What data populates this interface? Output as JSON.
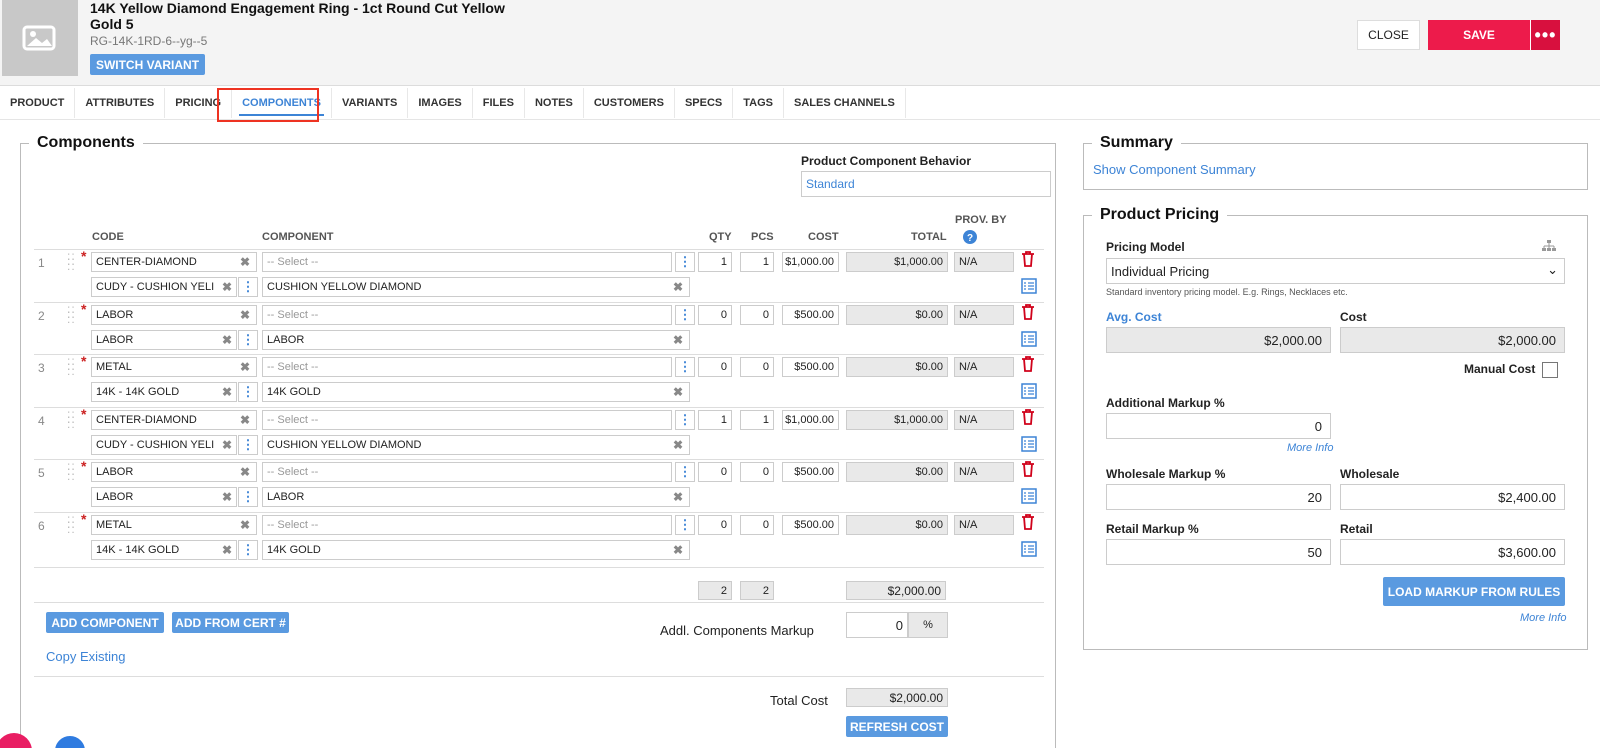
{
  "header": {
    "title": "14K Yellow Diamond Engagement Ring - 1ct Round Cut Yellow Gold 5",
    "sku": "RG-14K-1RD-6--yg--5",
    "switch_variant": "SWITCH VARIANT",
    "close": "CLOSE",
    "save": "SAVE",
    "more": "•••"
  },
  "tabs": [
    "PRODUCT",
    "ATTRIBUTES",
    "PRICING",
    "COMPONENTS",
    "VARIANTS",
    "IMAGES",
    "FILES",
    "NOTES",
    "CUSTOMERS",
    "SPECS",
    "TAGS",
    "SALES CHANNELS"
  ],
  "active_tab": "COMPONENTS",
  "components": {
    "legend": "Components",
    "behavior_label": "Product Component Behavior",
    "behavior_value": "Standard",
    "columns": {
      "code": "CODE",
      "component": "COMPONENT",
      "qty": "QTY",
      "pcs": "PCS",
      "cost": "COST",
      "total": "TOTAL",
      "prov_by": "PROV. BY"
    },
    "rows": [
      {
        "num": "1",
        "code": "CENTER-DIAMOND",
        "select": "-- Select --",
        "qty": "1",
        "pcs": "1",
        "cost": "$1,000.00",
        "total": "$1,000.00",
        "prov": "N/A",
        "sub_code": "CUDY - CUSHION YELI",
        "sub_component": "CUSHION YELLOW DIAMOND"
      },
      {
        "num": "2",
        "code": "LABOR",
        "select": "-- Select --",
        "qty": "0",
        "pcs": "0",
        "cost": "$500.00",
        "total": "$0.00",
        "prov": "N/A",
        "sub_code": "LABOR",
        "sub_component": "LABOR"
      },
      {
        "num": "3",
        "code": "METAL",
        "select": "-- Select --",
        "qty": "0",
        "pcs": "0",
        "cost": "$500.00",
        "total": "$0.00",
        "prov": "N/A",
        "sub_code": "14K - 14K GOLD",
        "sub_component": "14K GOLD"
      },
      {
        "num": "4",
        "code": "CENTER-DIAMOND",
        "select": "-- Select --",
        "qty": "1",
        "pcs": "1",
        "cost": "$1,000.00",
        "total": "$1,000.00",
        "prov": "N/A",
        "sub_code": "CUDY - CUSHION YELI",
        "sub_component": "CUSHION YELLOW DIAMOND"
      },
      {
        "num": "5",
        "code": "LABOR",
        "select": "-- Select --",
        "qty": "0",
        "pcs": "0",
        "cost": "$500.00",
        "total": "$0.00",
        "prov": "N/A",
        "sub_code": "LABOR",
        "sub_component": "LABOR"
      },
      {
        "num": "6",
        "code": "METAL",
        "select": "-- Select --",
        "qty": "0",
        "pcs": "0",
        "cost": "$500.00",
        "total": "$0.00",
        "prov": "N/A",
        "sub_code": "14K - 14K GOLD",
        "sub_component": "14K GOLD"
      }
    ],
    "totals": {
      "qty": "2",
      "pcs": "2",
      "total": "$2,000.00"
    },
    "add_component": "ADD COMPONENT",
    "add_from_cert": "ADD FROM CERT #",
    "copy_existing": "Copy Existing",
    "addl_markup_label": "Addl. Components Markup",
    "addl_markup_value": "0",
    "addl_markup_unit": "%",
    "total_cost_label": "Total Cost",
    "total_cost_value": "$2,000.00",
    "refresh_cost": "REFRESH COST"
  },
  "summary": {
    "legend": "Summary",
    "show_link": "Show Component Summary"
  },
  "pricing": {
    "legend": "Product Pricing",
    "model_label": "Pricing Model",
    "model_value": "Individual Pricing",
    "model_hint": "Standard inventory pricing model. E.g. Rings, Necklaces etc.",
    "avg_cost_label": "Avg. Cost",
    "avg_cost_value": "$2,000.00",
    "cost_label": "Cost",
    "cost_value": "$2,000.00",
    "manual_cost_label": "Manual Cost",
    "add_markup_label": "Additional Markup %",
    "add_markup_value": "0",
    "more_info": "More Info",
    "wholesale_markup_label": "Wholesale Markup %",
    "wholesale_markup_value": "20",
    "wholesale_label": "Wholesale",
    "wholesale_value": "$2,400.00",
    "retail_markup_label": "Retail Markup %",
    "retail_markup_value": "50",
    "retail_label": "Retail",
    "retail_value": "$3,600.00",
    "load_markup": "LOAD MARKUP FROM RULES",
    "more_info_2": "More Info"
  }
}
